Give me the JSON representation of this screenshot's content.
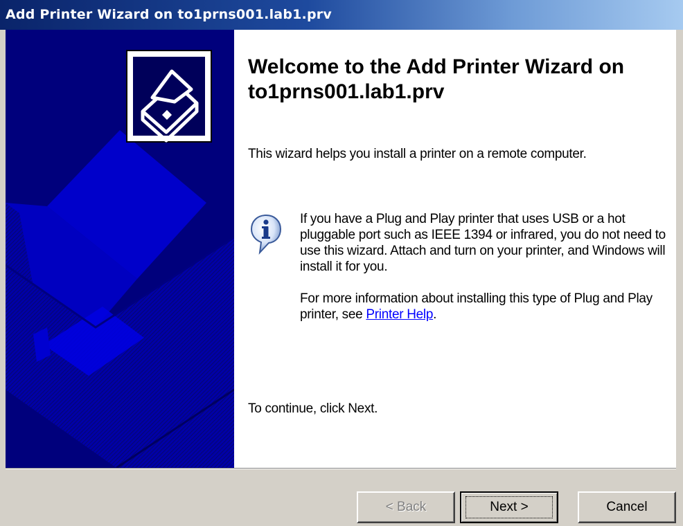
{
  "window": {
    "title": "Add Printer Wizard on to1prns001.lab1.prv"
  },
  "wizard": {
    "heading": "Welcome to the Add Printer Wizard on to1prns001.lab1.prv",
    "intro": "This wizard helps you install a printer on a remote computer.",
    "info_paragraph": "If you have a Plug and Play printer that uses USB or a hot pluggable port such as IEEE 1394 or infrared, you do not need to use this wizard. Attach and turn on your printer, and Windows will install it for you.",
    "more_info_prefix": "For more information about installing this type of Plug and Play printer, see ",
    "help_link": "Printer Help",
    "more_info_suffix": ".",
    "continue_text": "To continue, click Next.",
    "info_icon": "info-icon",
    "printer_icon": "printer-icon"
  },
  "buttons": {
    "back_label": "< Back",
    "next_label": "Next >",
    "cancel_label": "Cancel",
    "back_enabled": false
  },
  "colors": {
    "title_bar_start": "#0a246a",
    "title_bar_end": "#a6caf0",
    "watermark_bg": "#00007c",
    "link": "#0000ff",
    "dialog_bg": "#d4d0c8"
  }
}
